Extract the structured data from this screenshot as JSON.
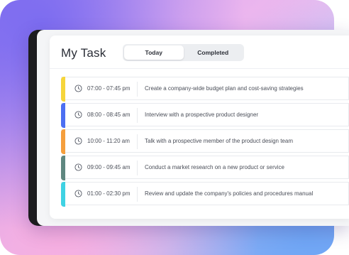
{
  "header": {
    "title": "My Task"
  },
  "tabs": [
    {
      "label": "Today",
      "active": true
    },
    {
      "label": "Completed",
      "active": false
    }
  ],
  "tasks": [
    {
      "time": "07:00 - 07:45 pm",
      "description": "Create a company-wide budget plan and cost-saving strategies",
      "color": "#f6d53b"
    },
    {
      "time": "08:00 - 08:45 am",
      "description": "Interview with a prospective product designer",
      "color": "#4c6ff2"
    },
    {
      "time": "10:00 - 11:20 am",
      "description": "Talk with a prospective member of the product design team",
      "color": "#f59f3d"
    },
    {
      "time": "09:00 - 09:45 am",
      "description": "Conduct a market research on a new product or service",
      "color": "#5f8780"
    },
    {
      "time": "01:00 - 02:30 pm",
      "description": "Review and update the company's policies and procedures manual",
      "color": "#3fd2e3"
    }
  ],
  "icons": {
    "task_time": "clock-icon"
  },
  "colors": {
    "panel": "#ffffff",
    "text": "#2a2d36",
    "tab_track": "#eceef1"
  }
}
